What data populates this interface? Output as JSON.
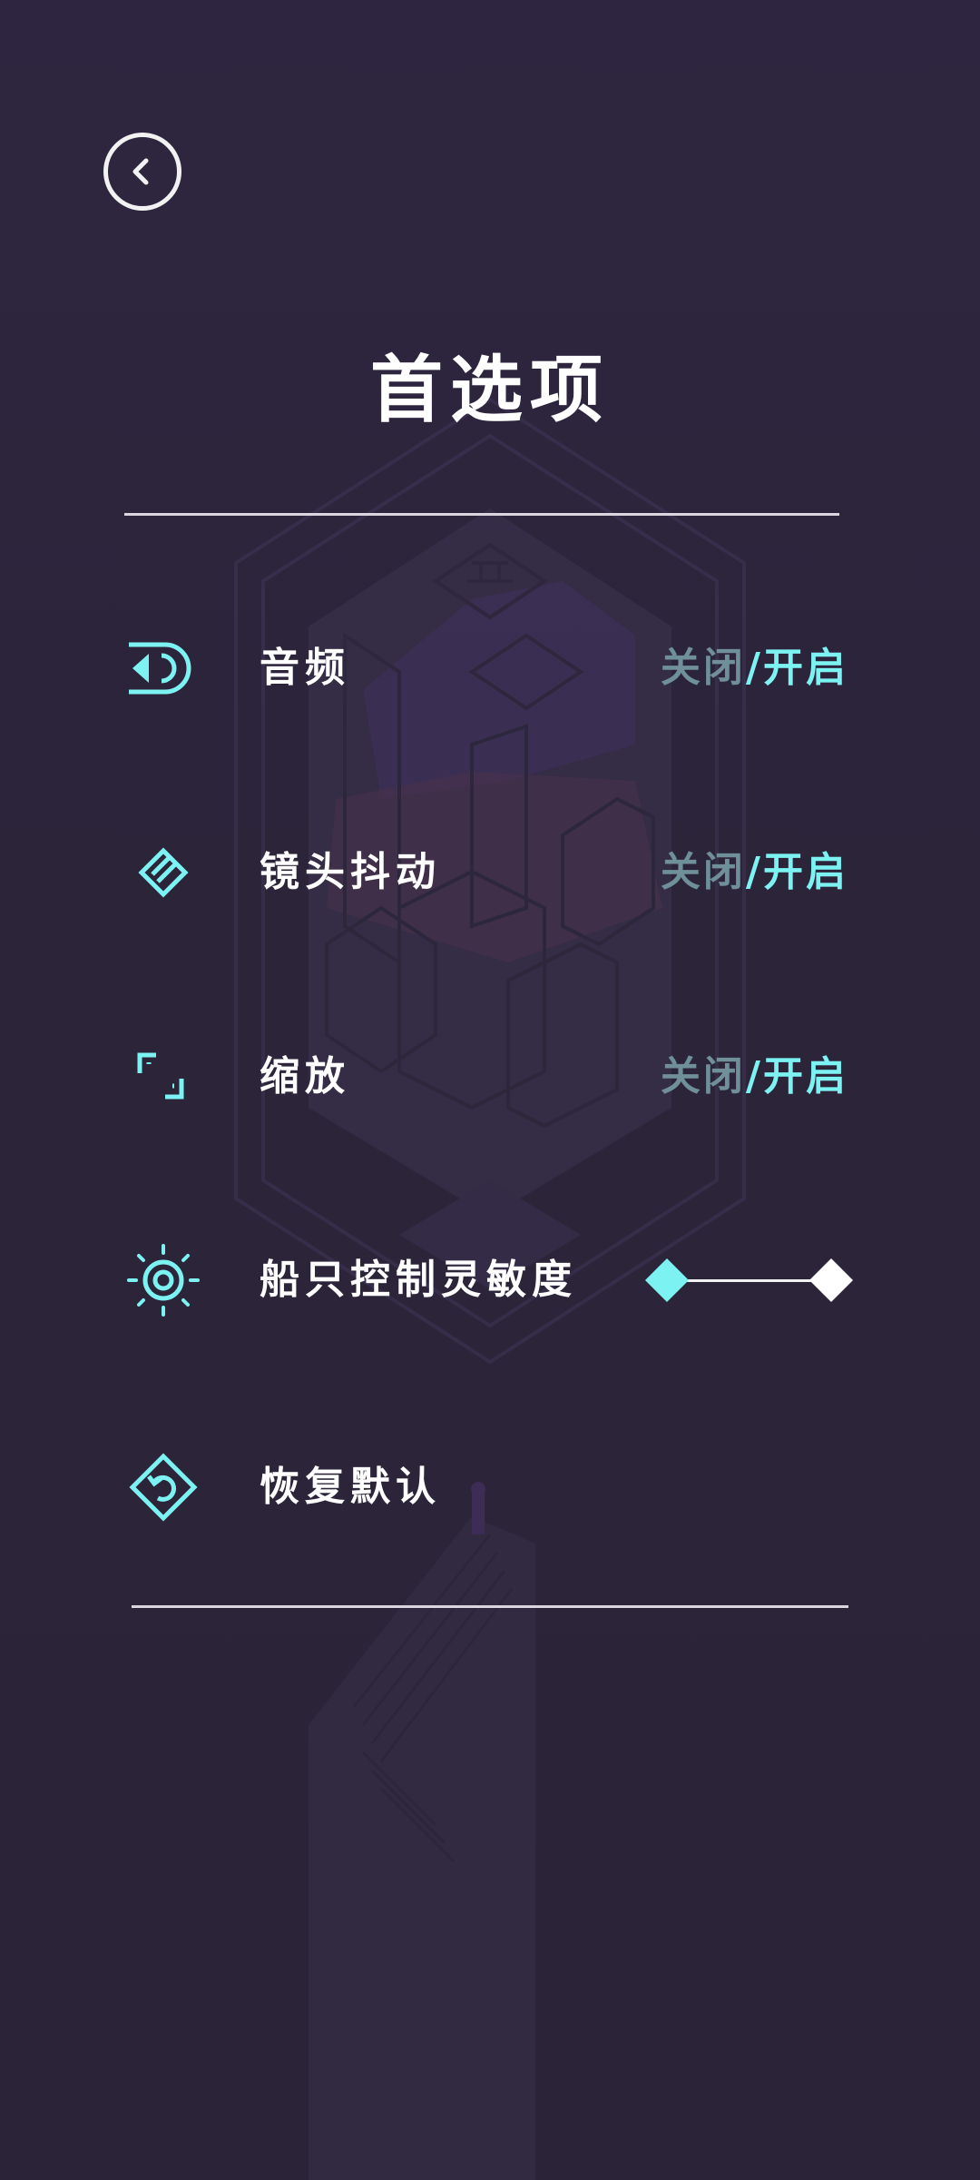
{
  "header": {
    "title": "首选项"
  },
  "settings": [
    {
      "label": "音频",
      "icon": "audio-icon",
      "off_label": "关闭",
      "separator": "/",
      "on_label": "开启",
      "state": "on"
    },
    {
      "label": "镜头抖动",
      "icon": "camera-shake-icon",
      "off_label": "关闭",
      "separator": "/",
      "on_label": "开启",
      "state": "on"
    },
    {
      "label": "缩放",
      "icon": "zoom-frame-icon",
      "off_label": "关闭",
      "separator": "/",
      "on_label": "开启",
      "state": "on"
    },
    {
      "label": "船只控制灵敏度",
      "icon": "sensitivity-target-icon",
      "slider_value": 0.0
    },
    {
      "label": "恢复默认",
      "icon": "restore-default-icon"
    }
  ],
  "colors": {
    "accent": "#7cf3f2",
    "inactive": "#6f8f99",
    "text": "#ffffff",
    "background": "#2b2439"
  }
}
